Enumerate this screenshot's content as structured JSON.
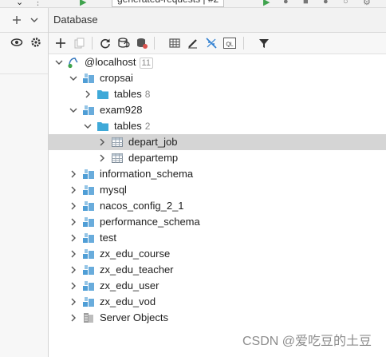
{
  "top": {
    "tab_fragment": "generated-requests | #2"
  },
  "panel": {
    "title": "Database"
  },
  "toolbar": {
    "buttons": [
      "add-icon",
      "duplicate-icon",
      "refresh-icon",
      "schema-sync-icon",
      "datasource-properties-icon",
      "table-view-icon",
      "edit-icon",
      "jump-to-source-icon",
      "query-console-icon",
      "filter-icon"
    ]
  },
  "tree": {
    "root": {
      "label": "@localhost",
      "count": "11"
    },
    "cropsai": {
      "label": "cropsai",
      "tables_label": "tables",
      "tables_count": "8"
    },
    "exam928": {
      "label": "exam928",
      "tables_label": "tables",
      "tables_count": "2",
      "tables": [
        "depart_job",
        "departemp"
      ]
    },
    "schemas": [
      "information_schema",
      "mysql",
      "nacos_config_2_1",
      "performance_schema",
      "test",
      "zx_edu_course",
      "zx_edu_teacher",
      "zx_edu_user",
      "zx_edu_vod"
    ],
    "server_objects": "Server Objects"
  },
  "watermark": "CSDN @爱吃豆的土豆",
  "colors": {
    "folder_blue": "#3fa9d8",
    "schema_blue": "#4f9ed6",
    "selection": "#d5d5d5",
    "accent_green": "#3fa34d"
  }
}
